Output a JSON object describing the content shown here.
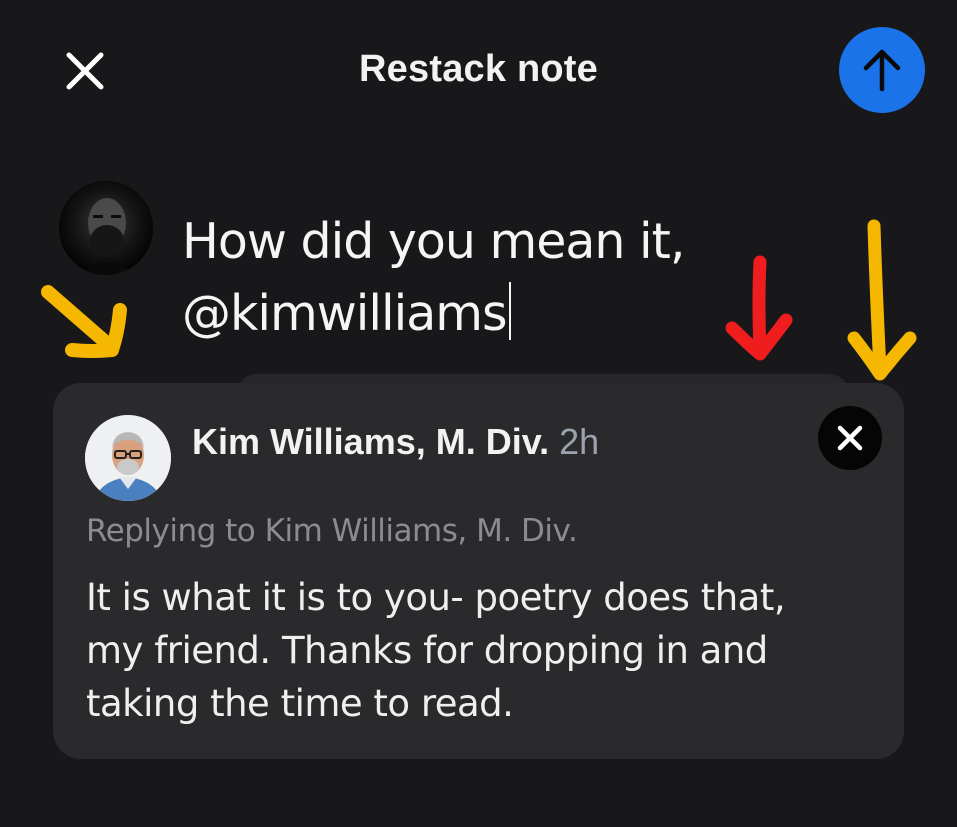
{
  "header": {
    "title": "Restack note",
    "close_icon": "close-icon",
    "post_icon": "arrow-up-icon",
    "post_color": "#1a73e8"
  },
  "composer": {
    "lines": [
      "How did you mean it,",
      "@kimwilliams"
    ]
  },
  "quoted_note": {
    "author": "Kim Williams, M. Div.",
    "time": "2h",
    "replying_to": "Replying to Kim Williams, M. Div.",
    "body_lines": [
      "It is what it is to you- poetry does that,",
      "my friend. Thanks for dropping in and",
      "taking the time to read."
    ],
    "remove_icon": "close-icon"
  },
  "annotations": {
    "arrow_colors": {
      "yellow": "#f5b700",
      "red": "#ef1d1d"
    }
  }
}
